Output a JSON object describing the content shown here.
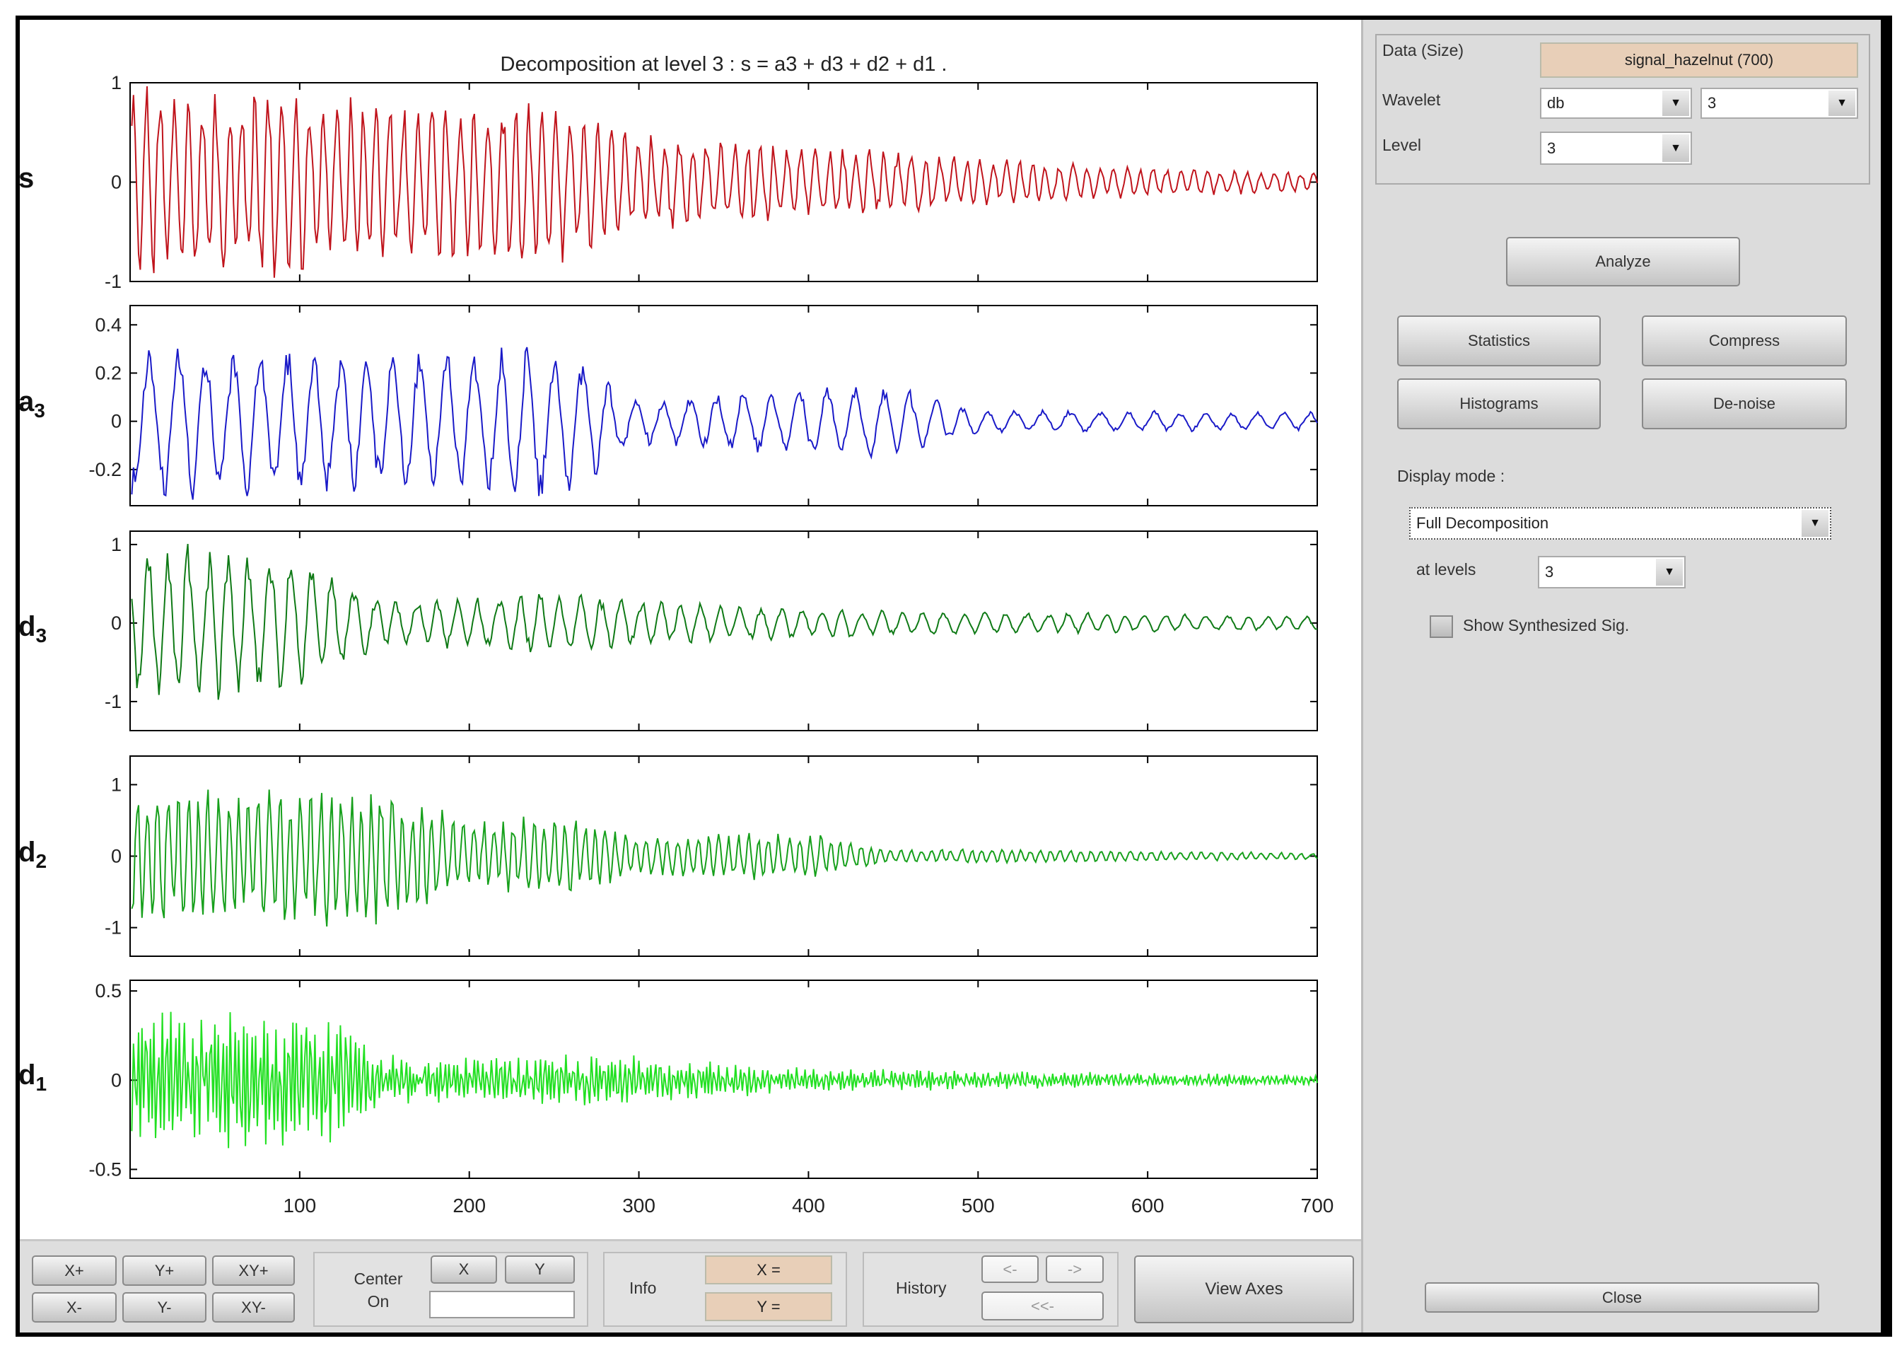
{
  "chart_data": {
    "type": "line",
    "title": "Decomposition at level 3 : s = a3 + d3 + d2 + d1 .",
    "xlim": [
      0,
      700
    ],
    "xticks": [
      100,
      200,
      300,
      400,
      500,
      600,
      700
    ],
    "series": [
      {
        "name": "s",
        "label": "s",
        "sub": "",
        "color": "#c0141c",
        "ylim": [
          -1,
          1
        ],
        "yticks": [
          -1,
          0,
          1
        ],
        "period": 8,
        "env_x": [
          0,
          100,
          150,
          250,
          300,
          400,
          500,
          600,
          700
        ],
        "env_y": [
          1.0,
          1.0,
          0.8,
          0.9,
          0.5,
          0.4,
          0.25,
          0.15,
          0.1
        ]
      },
      {
        "name": "a3",
        "label": "a",
        "sub": "3",
        "color": "#1a1ac8",
        "ylim": [
          -0.35,
          0.48
        ],
        "yticks": [
          -0.2,
          0,
          0.2,
          0.4
        ],
        "period": 16,
        "env_x": [
          0,
          100,
          200,
          250,
          300,
          400,
          450,
          500,
          700
        ],
        "env_y": [
          0.35,
          0.3,
          0.3,
          0.35,
          0.1,
          0.15,
          0.15,
          0.05,
          0.04
        ]
      },
      {
        "name": "d3",
        "label": "d",
        "sub": "3",
        "color": "#0f7a16",
        "ylim": [
          -1.37,
          1.17
        ],
        "yticks": [
          -1,
          0,
          1
        ],
        "period": 12,
        "env_x": [
          0,
          100,
          150,
          250,
          300,
          400,
          500,
          700
        ],
        "env_y": [
          1.1,
          0.9,
          0.3,
          0.4,
          0.3,
          0.2,
          0.15,
          0.1
        ]
      },
      {
        "name": "d2",
        "label": "d",
        "sub": "2",
        "color": "#17a01c",
        "ylim": [
          -1.4,
          1.4
        ],
        "yticks": [
          -1,
          0,
          1
        ],
        "period": 6,
        "env_x": [
          0,
          150,
          200,
          250,
          300,
          400,
          450,
          500,
          700
        ],
        "env_y": [
          1.0,
          1.0,
          0.5,
          0.6,
          0.3,
          0.35,
          0.1,
          0.1,
          0.05
        ]
      },
      {
        "name": "d1",
        "label": "d",
        "sub": "1",
        "color": "#22e022",
        "ylim": [
          -0.55,
          0.56
        ],
        "yticks": [
          -0.5,
          0,
          0.5
        ],
        "period": 2.5,
        "env_x": [
          0,
          120,
          150,
          300,
          400,
          700
        ],
        "env_y": [
          0.4,
          0.4,
          0.15,
          0.15,
          0.07,
          0.03
        ]
      }
    ]
  },
  "panel": {
    "data_label": "Data  (Size)",
    "data_value": "signal_hazelnut  (700)",
    "wavelet_label": "Wavelet",
    "wavelet_family": "db",
    "wavelet_order": "3",
    "level_label": "Level",
    "level_value": "3",
    "analyze": "Analyze",
    "statistics": "Statistics",
    "compress": "Compress",
    "histograms": "Histograms",
    "denoise": "De-noise",
    "display_mode_label": "Display mode :",
    "display_mode_value": "Full Decomposition",
    "at_levels_label": "at levels",
    "at_levels_value": "3",
    "show_synth": "Show Synthesized Sig.",
    "close": "Close"
  },
  "toolbar": {
    "xplus": "X+",
    "yplus": "Y+",
    "xyplus": "XY+",
    "xminus": "X-",
    "yminus": "Y-",
    "xyminus": "XY-",
    "center_on": "Center On",
    "center_x": "X",
    "center_y": "Y",
    "center_value": "",
    "info": "Info",
    "info_x": "X =",
    "info_y": "Y =",
    "history": "History",
    "hist_back": "<-",
    "hist_fwd": "->",
    "hist_first": "<<-",
    "view_axes": "View Axes"
  }
}
